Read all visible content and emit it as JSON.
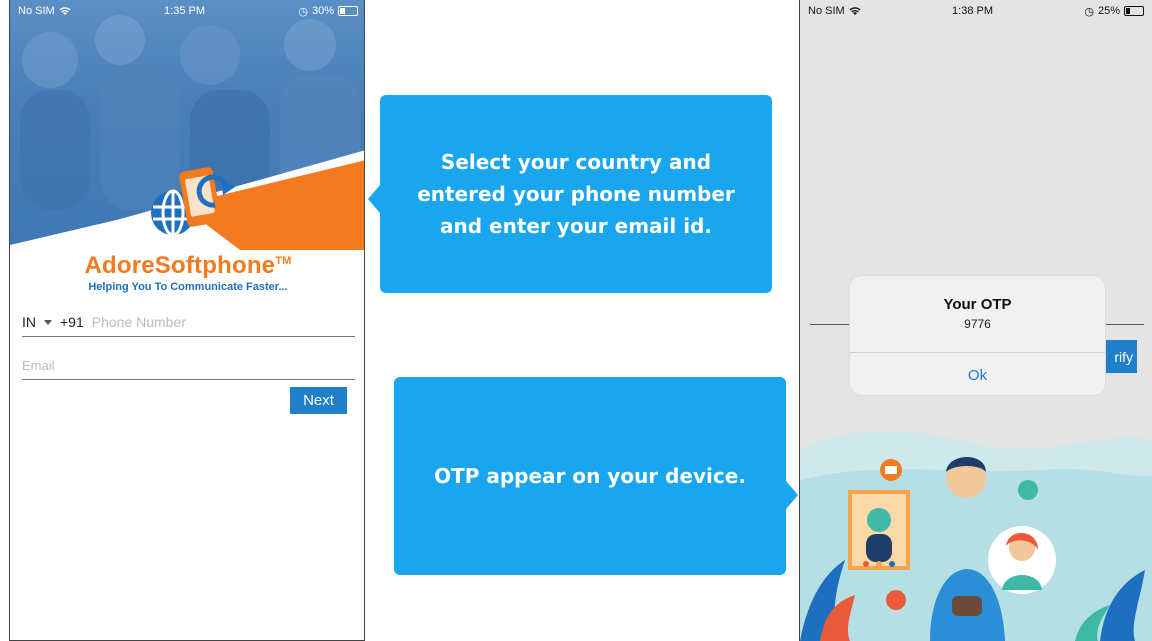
{
  "screen1": {
    "status": {
      "carrier": "No SIM",
      "time": "1:35 PM",
      "battery": "30%",
      "battery_level": 0.3
    },
    "brand": {
      "name": "AdoreSoftphone",
      "tm": "TM",
      "tagline": "Helping You To Communicate Faster..."
    },
    "country_code": "IN",
    "dial_code": "+91",
    "phone_placeholder": "Phone Number",
    "email_placeholder": "Email",
    "next_label": "Next"
  },
  "callout1": {
    "text": "Select your country and entered your phone number and enter your email id."
  },
  "callout2": {
    "text": "OTP appear on your device."
  },
  "screen2": {
    "status": {
      "carrier": "No SIM",
      "time": "1:38 PM",
      "battery": "25%",
      "battery_level": 0.25
    },
    "verify_label": "rify",
    "alert": {
      "title": "Your OTP",
      "message": "9776",
      "ok_label": "Ok"
    }
  },
  "colors": {
    "accent_blue": "#1aa5ef",
    "button_blue": "#1f7fc9",
    "brand_orange": "#f37a1f",
    "brand_blue": "#1f6fc1",
    "ios_link": "#1b7bd6"
  },
  "icons": [
    "wifi-icon",
    "alarm-icon",
    "battery-icon",
    "dropdown-caret-icon",
    "globe-phone-logo-icon",
    "mail-icon",
    "phone-icon",
    "heart-icon"
  ]
}
